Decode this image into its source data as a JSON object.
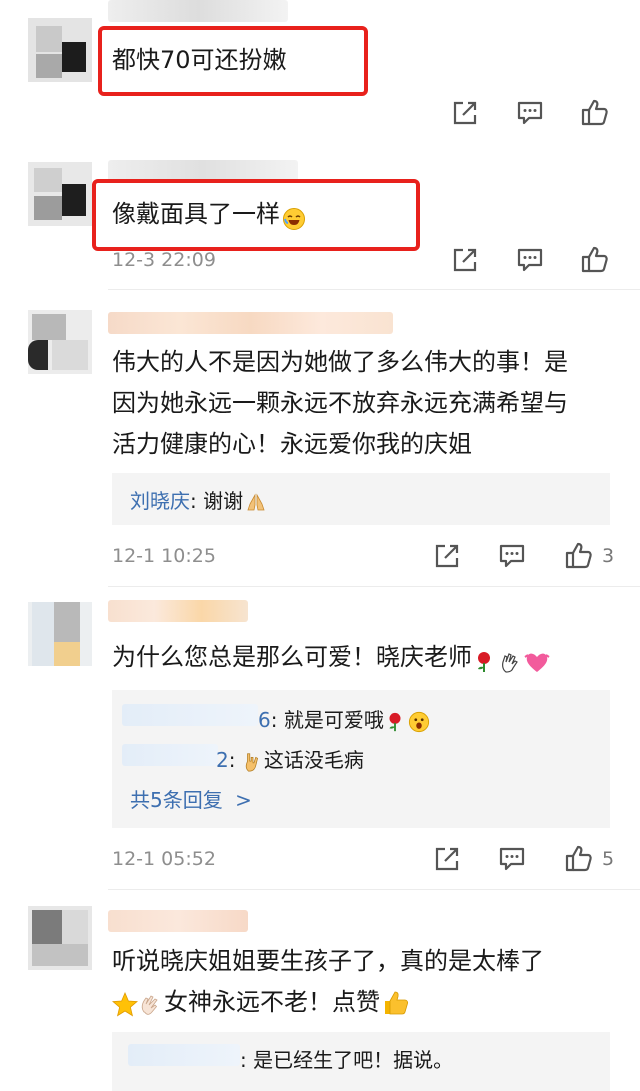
{
  "comments": [
    {
      "text": "都快70可还扮嫩"
    },
    {
      "text": "像戴面具了一样",
      "time": "12-3 22:09"
    },
    {
      "lines": [
        "伟大的人不是因为她做了多么伟大的事！是",
        "因为她永远一颗永远不放弃永远充满希望与",
        "活力健康的心！永远爱你我的庆姐"
      ],
      "reply": {
        "user": "刘晓庆",
        "sep": ": ",
        "text": "谢谢"
      },
      "time": "12-1 10:25",
      "likes": "3"
    },
    {
      "text": "为什么您总是那么可爱！晓庆老师",
      "replies": [
        {
          "user_tail": "6",
          "sep": ": ",
          "text": "就是可爱哦"
        },
        {
          "user_tail": "2",
          "sep": ": ",
          "text": "这话没毛病"
        }
      ],
      "more": "共5条回复",
      "more_arrow": ">",
      "time": "12-1 05:52",
      "likes": "5"
    },
    {
      "lines": [
        "听说晓庆姐姐要生孩子了，真的是太棒了",
        "女神永远不老！点赞"
      ],
      "reply": {
        "sep": ": ",
        "text": "是已经生了吧！据说。"
      }
    }
  ],
  "icons": [
    "share-icon",
    "comment-icon",
    "like-icon"
  ],
  "colors": {
    "highlight": "#e8211c",
    "link": "#3d6fb0",
    "meta": "#8e8e8e"
  }
}
